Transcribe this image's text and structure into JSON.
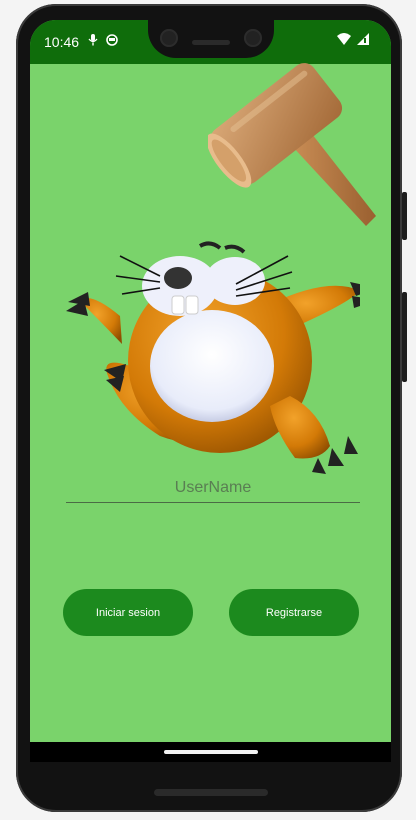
{
  "status_bar": {
    "time": "10:46",
    "icons_left": [
      "mic-icon",
      "circle-face-icon"
    ],
    "icons_right": [
      "wifi-icon",
      "signal-icon"
    ]
  },
  "login": {
    "username_placeholder": "UserName",
    "username_value": "",
    "login_button_label": "Iniciar sesion",
    "register_button_label": "Registrarse"
  },
  "colors": {
    "background": "#7ad36b",
    "status_bar": "#0f6d0b",
    "button": "#1c8a1e",
    "button_text": "#ffffff"
  }
}
